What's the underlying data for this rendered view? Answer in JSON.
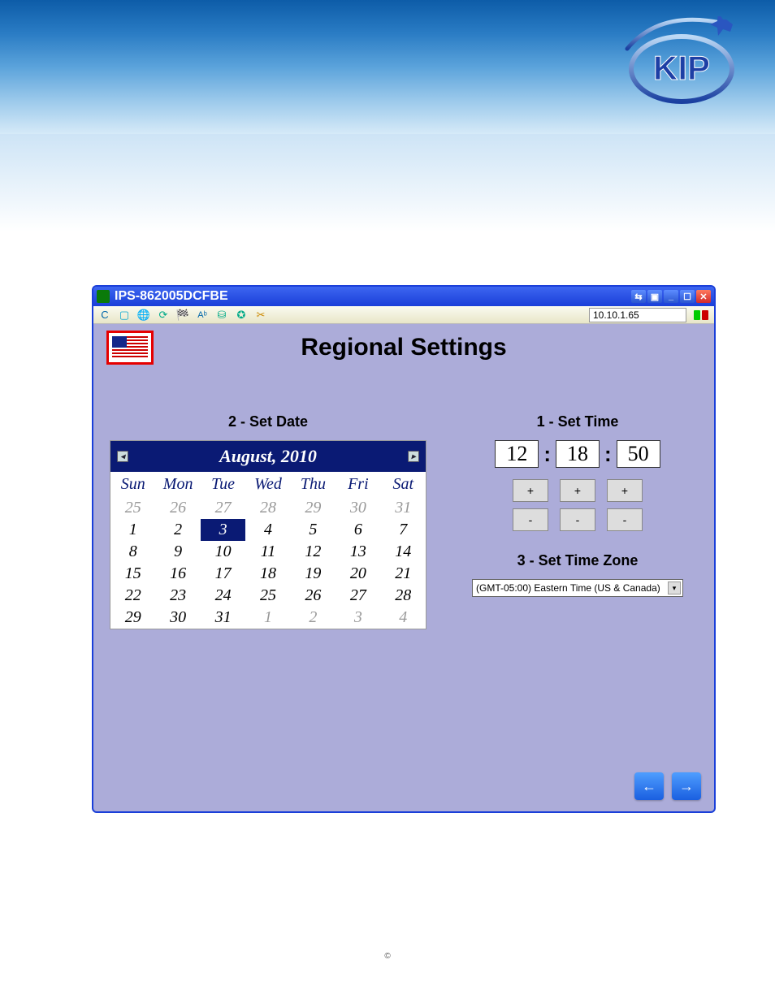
{
  "window": {
    "title": "IPS-862005DCFBE",
    "ip": "10.10.1.65"
  },
  "page": {
    "title": "Regional Settings"
  },
  "sections": {
    "date_label": "2 - Set Date",
    "time_label": "1 - Set Time",
    "tz_label": "3 - Set Time Zone"
  },
  "calendar": {
    "month_label": "August, 2010",
    "dow": [
      "Sun",
      "Mon",
      "Tue",
      "Wed",
      "Thu",
      "Fri",
      "Sat"
    ],
    "days": [
      {
        "n": "25",
        "grey": true
      },
      {
        "n": "26",
        "grey": true
      },
      {
        "n": "27",
        "grey": true
      },
      {
        "n": "28",
        "grey": true
      },
      {
        "n": "29",
        "grey": true
      },
      {
        "n": "30",
        "grey": true
      },
      {
        "n": "31",
        "grey": true
      },
      {
        "n": "1"
      },
      {
        "n": "2"
      },
      {
        "n": "3",
        "sel": true
      },
      {
        "n": "4"
      },
      {
        "n": "5"
      },
      {
        "n": "6"
      },
      {
        "n": "7"
      },
      {
        "n": "8"
      },
      {
        "n": "9"
      },
      {
        "n": "10"
      },
      {
        "n": "11"
      },
      {
        "n": "12"
      },
      {
        "n": "13"
      },
      {
        "n": "14"
      },
      {
        "n": "15"
      },
      {
        "n": "16"
      },
      {
        "n": "17"
      },
      {
        "n": "18"
      },
      {
        "n": "19"
      },
      {
        "n": "20"
      },
      {
        "n": "21"
      },
      {
        "n": "22"
      },
      {
        "n": "23"
      },
      {
        "n": "24"
      },
      {
        "n": "25"
      },
      {
        "n": "26"
      },
      {
        "n": "27"
      },
      {
        "n": "28"
      },
      {
        "n": "29"
      },
      {
        "n": "30"
      },
      {
        "n": "31"
      },
      {
        "n": "1",
        "grey": true
      },
      {
        "n": "2",
        "grey": true
      },
      {
        "n": "3",
        "grey": true
      },
      {
        "n": "4",
        "grey": true
      }
    ]
  },
  "time": {
    "h": "12",
    "m": "18",
    "s": "50",
    "plus": "+",
    "minus": "-"
  },
  "tz": {
    "selected": "(GMT-05:00) Eastern Time (US & Canada)"
  },
  "icons": {
    "prev": "◂",
    "next": "▸",
    "left_arrow": "←",
    "right_arrow": "→",
    "caret_down": "▾"
  },
  "footer": {
    "copy": "©"
  }
}
